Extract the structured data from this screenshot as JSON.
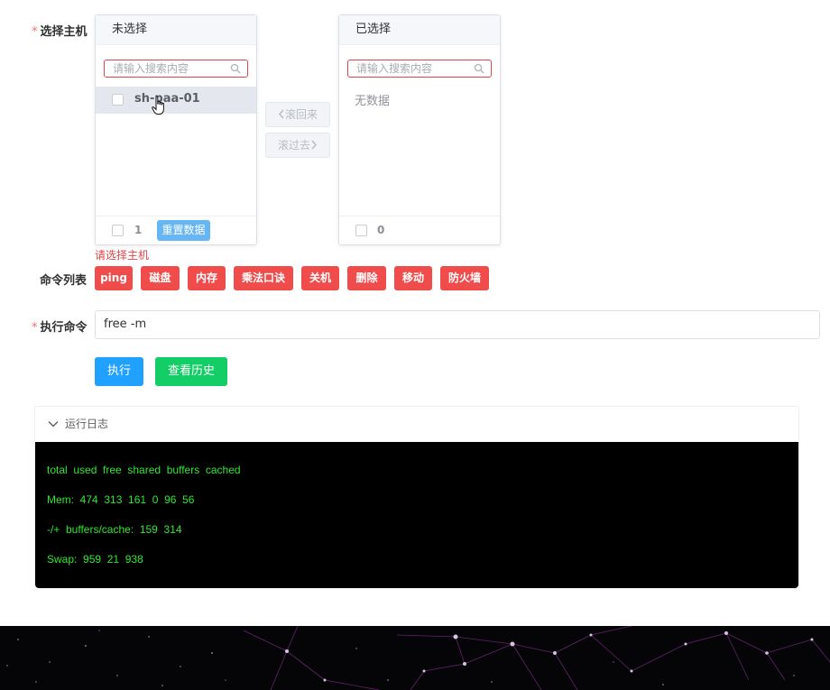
{
  "form": {
    "host_label": "选择主机",
    "commands_label": "命令列表",
    "exec_label": "执行命令",
    "required_mark": "*"
  },
  "transfer": {
    "left": {
      "title": "未选择",
      "search_placeholder": "请输入搜索内容",
      "items": [
        "sh-paa-01"
      ],
      "count": "1",
      "reset_label": "重置数据"
    },
    "right": {
      "title": "已选择",
      "search_placeholder": "请输入搜索内容",
      "empty_text": "无数据",
      "count": "0"
    },
    "to_left_label": "滚回来",
    "to_right_label": "滚过去"
  },
  "error": {
    "host_required": "请选择主机"
  },
  "commands": [
    "ping",
    "磁盘",
    "内存",
    "乘法口诀",
    "关机",
    "删除",
    "移动",
    "防火墙"
  ],
  "command_input": {
    "value": "free -m"
  },
  "buttons": {
    "execute": "执行",
    "history": "查看历史"
  },
  "log": {
    "title": "运行日志",
    "lines": [
      "total  used  free  shared  buffers  cached",
      "Mem:  474  313  161  0  96  56",
      "-/+  buffers/cache:  159  314",
      "Swap:  959  21  938"
    ]
  },
  "colors": {
    "danger": "#f14c4c",
    "primary": "#20a0ff",
    "success": "#13ce66",
    "terminal_text": "#2ee82e"
  }
}
